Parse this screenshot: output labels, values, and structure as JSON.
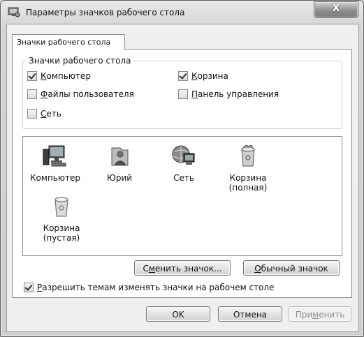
{
  "window": {
    "title": "Параметры значков рабочего стола",
    "close_label": "X"
  },
  "tab": {
    "label": "Значки рабочего стола"
  },
  "group": {
    "legend": "Значки рабочего стола",
    "checkboxes": [
      {
        "prefix": "",
        "accel": "К",
        "rest": "омпьютер",
        "checked": true
      },
      {
        "prefix": "",
        "accel": "К",
        "rest": "орзина",
        "checked": true
      },
      {
        "prefix": "",
        "accel": "Ф",
        "rest": "айлы пользователя",
        "checked": false
      },
      {
        "prefix": "",
        "accel": "П",
        "rest": "анель управления",
        "checked": false
      },
      {
        "prefix": "",
        "accel": "С",
        "rest": "еть",
        "checked": false
      }
    ]
  },
  "icons": [
    {
      "label": "Компьютер",
      "icon": "computer-icon"
    },
    {
      "label": "Юрий",
      "icon": "user-folder-icon"
    },
    {
      "label": "Сеть",
      "icon": "network-icon"
    },
    {
      "label_line1": "Корзина",
      "label_line2": "(полная)",
      "icon": "recycle-bin-full-icon"
    },
    {
      "label_line1": "Корзина",
      "label_line2": "(пустая)",
      "icon": "recycle-bin-empty-icon"
    }
  ],
  "buttons": {
    "change_icon_pre": "С",
    "change_icon_accel": "м",
    "change_icon_post": "енить значок...",
    "default_icon_accel": "О",
    "default_icon_post": "бычный значок",
    "ok": "OK",
    "cancel": "Отмена",
    "apply_pre": "При",
    "apply_accel": "м",
    "apply_post": "енить"
  },
  "allow_themes": {
    "accel": "Р",
    "rest": "азрешить темам изменять значки на рабочем столе",
    "checked": true
  }
}
